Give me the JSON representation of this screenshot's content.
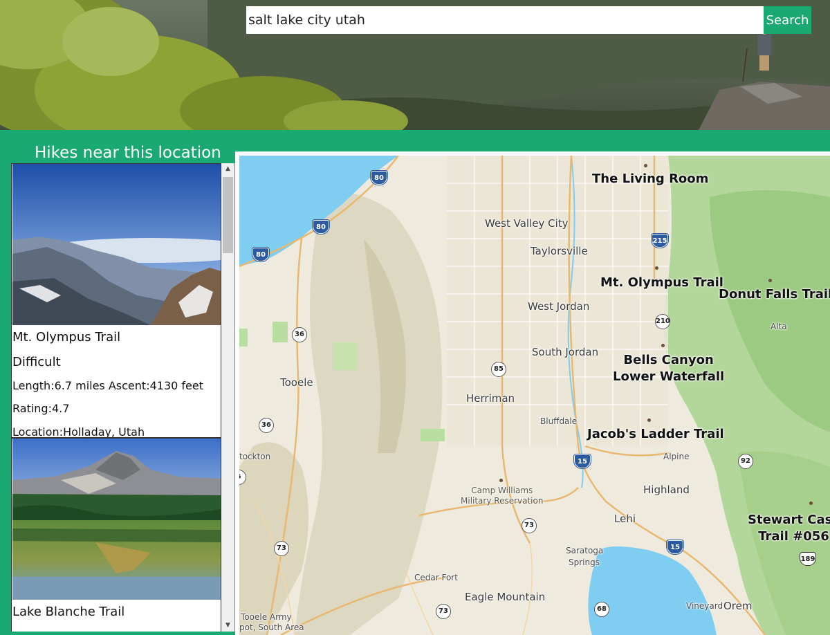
{
  "search": {
    "value": "salt lake city utah",
    "button_label": "Search"
  },
  "sidebar": {
    "title": "Hikes near this location",
    "hikes": [
      {
        "name": "Mt. Olympus Trail",
        "difficulty": "Difficult",
        "length_ascent": "Length:6.7 miles  Ascent:4130 feet",
        "rating": "Rating:4.7",
        "location": "Location:Holladay, Utah"
      },
      {
        "name": "Lake Blanche Trail",
        "difficulty": "",
        "length_ascent": "",
        "rating": "",
        "location": ""
      }
    ]
  },
  "map": {
    "cities": [
      "The Living Room",
      "West Valley City",
      "Taylorsville",
      "West Jordan",
      "South Jordan",
      "Tooele",
      "Herriman",
      "Bluffdale",
      "Alpine",
      "Highland",
      "Lehi",
      "Cedar Fort",
      "Eagle Mountain",
      "Vineyard",
      "Orem",
      "Alta",
      "Saratoga",
      "Springs",
      "tockton",
      "Tooele Army",
      "pot, South Area"
    ],
    "military": [
      "Camp Williams",
      "Military Reservation"
    ],
    "trails": [
      "Mt. Olympus Trail",
      "Donut Falls Trail",
      "Bells Canyon",
      "Lower Waterfall",
      "Jacob's Ladder Trail",
      "Stewart Casc",
      "Trail #056"
    ],
    "shields": [
      "80",
      "80",
      "80",
      "215",
      "210",
      "36",
      "36",
      "85",
      "15",
      "92",
      "73",
      "73",
      "73",
      "15",
      "68",
      "189",
      "6"
    ],
    "colors": {
      "water": "#7fcdf0",
      "terrain": "#eeeade",
      "forest": "#a8cf8f",
      "highway": "#e8b870",
      "interstate": "#2c5aa0",
      "accent": "#1aa873"
    }
  }
}
